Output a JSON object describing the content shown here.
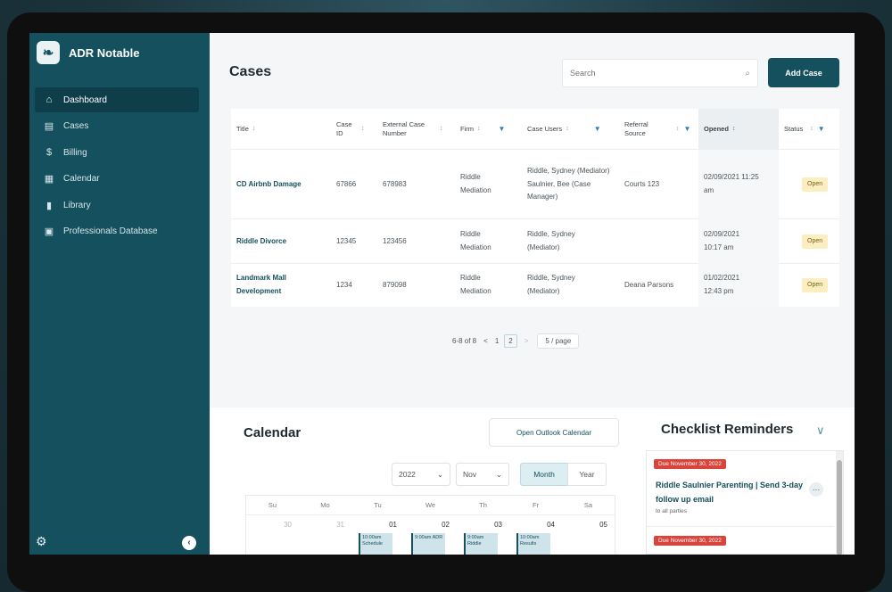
{
  "app": {
    "name": "ADR Notable",
    "logo_glyph": "❧"
  },
  "sidebar": {
    "items": [
      {
        "label": "Dashboard",
        "icon": "home-icon",
        "glyph": "⌂",
        "active": true
      },
      {
        "label": "Cases",
        "icon": "briefcase-icon",
        "glyph": "▤",
        "active": false
      },
      {
        "label": "Billing",
        "icon": "dollar-icon",
        "glyph": "$",
        "active": false
      },
      {
        "label": "Calendar",
        "icon": "calendar-icon",
        "glyph": "▦",
        "active": false
      },
      {
        "label": "Library",
        "icon": "bookmark-icon",
        "glyph": "▮",
        "active": false
      },
      {
        "label": "Professionals Database",
        "icon": "id-card-icon",
        "glyph": "▣",
        "active": false
      }
    ],
    "settings_glyph": "⚙",
    "collapse_glyph": "‹"
  },
  "cases": {
    "title": "Cases",
    "search_placeholder": "Search",
    "search_glyph": "⌕",
    "add_button": "Add Case",
    "columns": {
      "title": "Title",
      "case_id": "Case ID",
      "external": "External Case Number",
      "firm": "Firm",
      "case_users": "Case Users",
      "referral": "Referral Source",
      "opened": "Opened",
      "status": "Status"
    },
    "sort_glyph": "↕",
    "filter_glyph": "▼",
    "rows": [
      {
        "title": "CD Airbnb Damage",
        "case_id": "67866",
        "external": "678983",
        "firm": "Riddle Mediation",
        "users": "Riddle, Sydney (Mediator) Saulnier, Bee (Case Manager)",
        "referral": "Courts 123",
        "opened": "02/09/2021 11:25 am",
        "status": "Open"
      },
      {
        "title": "Riddle Divorce",
        "case_id": "12345",
        "external": "123456",
        "firm": "Riddle Mediation",
        "users": "Riddle, Sydney (Mediator)",
        "referral": "",
        "opened": "02/09/2021 10:17 am",
        "status": "Open"
      },
      {
        "title": "Landmark Mall Development",
        "case_id": "1234",
        "external": "879098",
        "firm": "Riddle Mediation",
        "users": "Riddle, Sydney (Mediator)",
        "referral": "Deana Parsons",
        "opened": "01/02/2021 12:43 pm",
        "status": "Open"
      }
    ],
    "pagination": {
      "range": "6-8 of 8",
      "prev": "<",
      "page1": "1",
      "page2": "2",
      "next": ">",
      "per_page": "5 / page"
    }
  },
  "calendar": {
    "title": "Calendar",
    "outlook_button": "Open Outlook Calendar",
    "year": "2022",
    "month": "Nov",
    "view_month": "Month",
    "view_year": "Year",
    "weekdays": [
      "Su",
      "Mo",
      "Tu",
      "We",
      "Th",
      "Fr",
      "Sa"
    ],
    "days": [
      "30",
      "31",
      "01",
      "02",
      "03",
      "04",
      "05"
    ],
    "events": [
      {
        "day_index": 2,
        "text": "10:00am Schedule"
      },
      {
        "day_index": 3,
        "text": "9:00am ADR"
      },
      {
        "day_index": 4,
        "text": "9:00am Riddle"
      },
      {
        "day_index": 5,
        "text": "10:00am Results"
      }
    ]
  },
  "checklist": {
    "title": "Checklist Reminders",
    "chevron_glyph": "∨",
    "items": [
      {
        "due": "Due November 30, 2022",
        "text": "Riddle Saulnier Parenting | Send 3-day follow up email",
        "sub": "to all parties"
      },
      {
        "due": "Due November 30, 2022"
      }
    ],
    "more_glyph": "…"
  },
  "colors": {
    "sidebar": "#15505e",
    "accent": "#15505e",
    "status_open": "#fbeec0",
    "due_badge": "#d9443b"
  }
}
